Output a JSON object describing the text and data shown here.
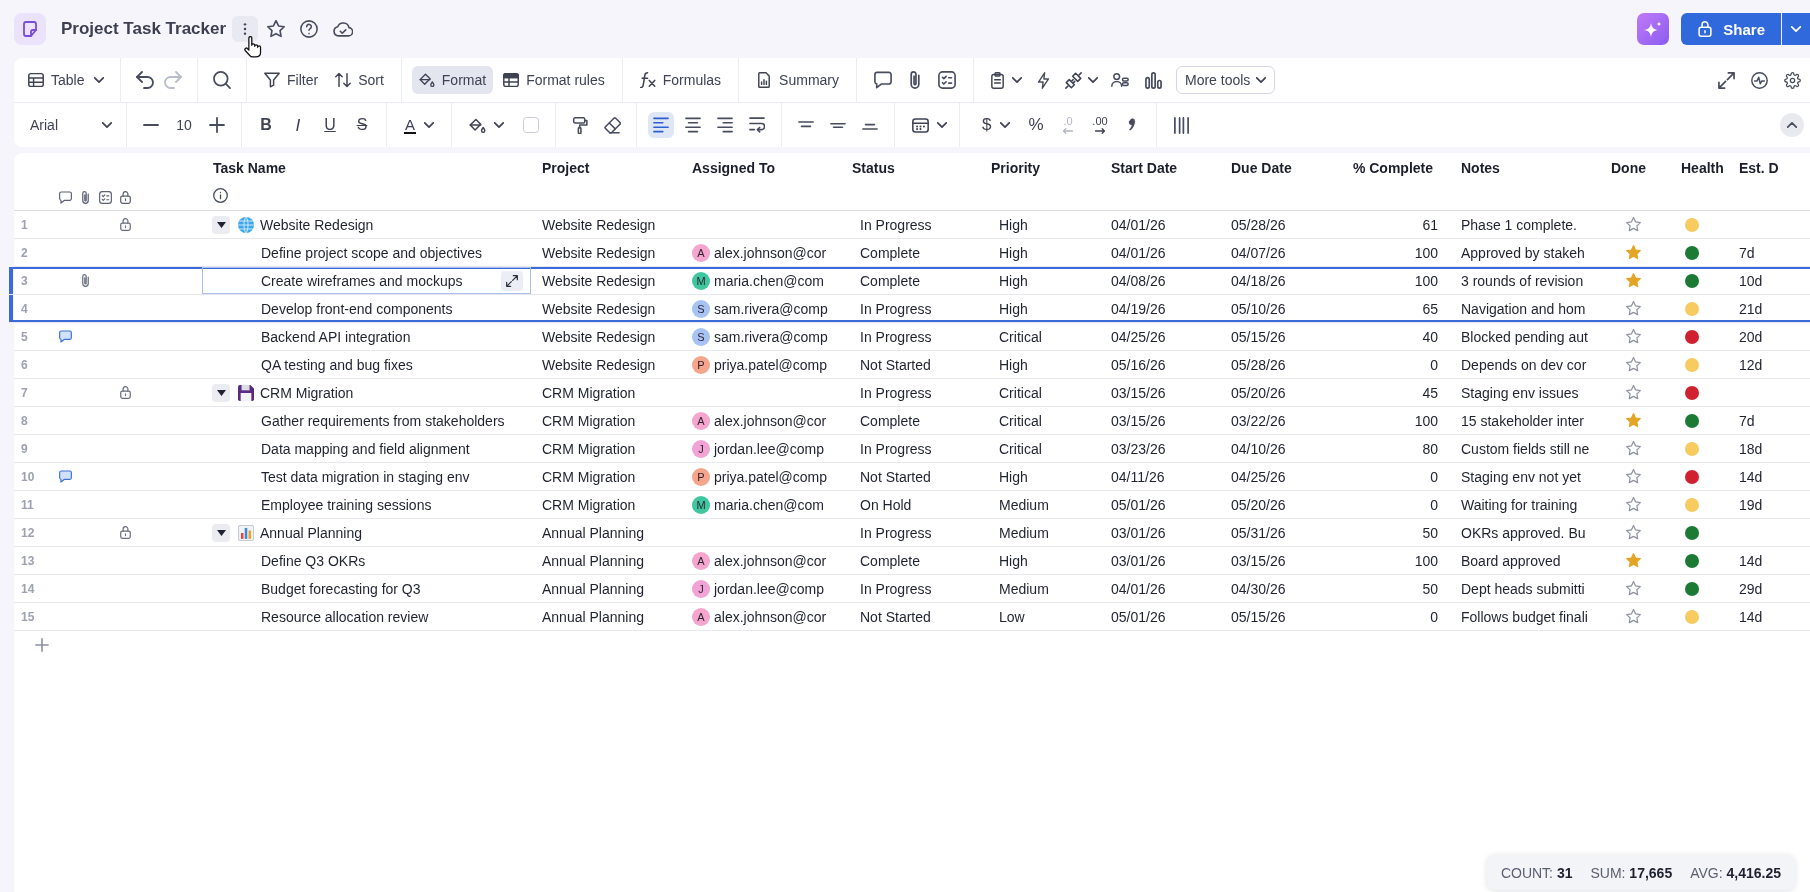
{
  "header": {
    "title": "Project Task Tracker",
    "share": "Share"
  },
  "toolbar": {
    "view": "Table",
    "history": [
      {
        "disabled": false
      },
      {
        "disabled": true
      }
    ],
    "tool_groups": [
      [
        {
          "label": "Filter",
          "selected": false
        },
        {
          "label": "Sort",
          "selected": false
        }
      ],
      [
        {
          "label": "Format",
          "selected": true
        },
        {
          "label": "Format rules",
          "selected": false
        }
      ],
      [
        {
          "label": "Formulas",
          "selected": false
        }
      ],
      [
        {
          "label": "Summary",
          "selected": false
        }
      ]
    ],
    "more_tools": "More tools"
  },
  "format_bar": {
    "font": "Arial",
    "size": "10",
    "text_styles": [
      "B",
      "I",
      "U",
      "S"
    ],
    "text_color": "A",
    "align": [
      {
        "selected": true
      },
      {
        "selected": false
      },
      {
        "selected": false
      },
      {
        "selected": false
      }
    ],
    "valign": [
      {
        "selected": false
      },
      {
        "selected": false
      },
      {
        "selected": false
      }
    ],
    "currency": "$",
    "percent": "%",
    "decimals": [
      {
        "label": ".0",
        "disabled": true
      },
      {
        "label": ".00",
        "disabled": false
      }
    ]
  },
  "table": {
    "columns": [
      "Task Name",
      "Project",
      "Assigned To",
      "Status",
      "Priority",
      "Start Date",
      "Due Date",
      "% Complete",
      "Notes",
      "Done",
      "Health",
      "Est. D"
    ],
    "rows": [
      {
        "num": "1",
        "task": "Website Redesign",
        "project": "Website Redesign",
        "status": "In Progress",
        "priority": "High",
        "start": "04/01/26",
        "due": "05/28/26",
        "percent": "61",
        "notes": "Phase 1 complete.",
        "done": false,
        "health": {
          "color": "#f7cb5f"
        },
        "comment": false,
        "attachment": false,
        "locked": true,
        "selected": false,
        "focused": false,
        "expanded": true,
        "children": [
          {
            "num": "2",
            "task": "Define project scope and objectives",
            "project": "Website Redesign",
            "assignee": {
              "initial": "A",
              "email": "alex.johnson@cor",
              "color": "#f4a6cf"
            },
            "status": "Complete",
            "priority": "High",
            "start": "04/01/26",
            "due": "04/07/26",
            "percent": "100",
            "notes": "Approved by stakeh",
            "done": true,
            "health": {
              "color": "#1c7a35"
            },
            "estimate": "7d",
            "comment": false,
            "attachment": false,
            "locked": false,
            "selected": false,
            "focused": false
          },
          {
            "num": "3",
            "task": "Create wireframes and mockups",
            "project": "Website Redesign",
            "assignee": {
              "initial": "M",
              "email": "maria.chen@com",
              "color": "#3fc7a0"
            },
            "status": "Complete",
            "priority": "High",
            "start": "04/08/26",
            "due": "04/18/26",
            "percent": "100",
            "notes": "3 rounds of revision",
            "done": true,
            "health": {
              "color": "#1c7a35"
            },
            "estimate": "10d",
            "comment": false,
            "attachment": true,
            "locked": false,
            "selected": true,
            "focused": true
          },
          {
            "num": "4",
            "task": "Develop front-end components",
            "project": "Website Redesign",
            "assignee": {
              "initial": "S",
              "email": "sam.rivera@comp",
              "color": "#a7c3f4"
            },
            "status": "In Progress",
            "priority": "High",
            "start": "04/19/26",
            "due": "05/10/26",
            "percent": "65",
            "notes": "Navigation and hom",
            "done": false,
            "health": {
              "color": "#f7cb5f"
            },
            "estimate": "21d",
            "comment": false,
            "attachment": false,
            "locked": false,
            "selected": true,
            "focused": false
          },
          {
            "num": "5",
            "task": "Backend API integration",
            "project": "Website Redesign",
            "assignee": {
              "initial": "S",
              "email": "sam.rivera@comp",
              "color": "#a7c3f4"
            },
            "status": "In Progress",
            "priority": "Critical",
            "start": "04/25/26",
            "due": "05/15/26",
            "percent": "40",
            "notes": "Blocked pending aut",
            "done": false,
            "health": {
              "color": "#d1202f"
            },
            "estimate": "20d",
            "comment": true,
            "attachment": false,
            "locked": false,
            "selected": false,
            "focused": false
          },
          {
            "num": "6",
            "task": "QA testing and bug fixes",
            "project": "Website Redesign",
            "assignee": {
              "initial": "P",
              "email": "priya.patel@comp",
              "color": "#f5a58b"
            },
            "status": "Not Started",
            "priority": "High",
            "start": "05/16/26",
            "due": "05/28/26",
            "percent": "0",
            "notes": "Depends on dev cor",
            "done": false,
            "health": {
              "color": "#f7cb5f"
            },
            "estimate": "12d",
            "comment": false,
            "attachment": false,
            "locked": false,
            "selected": false,
            "focused": false
          }
        ]
      },
      {
        "num": "7",
        "task": "CRM Migration",
        "project": "CRM Migration",
        "status": "In Progress",
        "priority": "Critical",
        "start": "03/15/26",
        "due": "05/20/26",
        "percent": "45",
        "notes": "Staging env issues",
        "done": false,
        "health": {
          "color": "#d1202f"
        },
        "comment": false,
        "attachment": false,
        "locked": true,
        "selected": false,
        "focused": false,
        "expanded": true,
        "children": [
          {
            "num": "8",
            "task": "Gather requirements from stakeholders",
            "project": "CRM Migration",
            "assignee": {
              "initial": "A",
              "email": "alex.johnson@cor",
              "color": "#f4a6cf"
            },
            "status": "Complete",
            "priority": "Critical",
            "start": "03/15/26",
            "due": "03/22/26",
            "percent": "100",
            "notes": "15 stakeholder inter",
            "done": true,
            "health": {
              "color": "#1c7a35"
            },
            "estimate": "7d",
            "comment": false,
            "attachment": false,
            "locked": false,
            "selected": false,
            "focused": false
          },
          {
            "num": "9",
            "task": "Data mapping and field alignment",
            "project": "CRM Migration",
            "assignee": {
              "initial": "J",
              "email": "jordan.lee@comp",
              "color": "#f1a3d6"
            },
            "status": "In Progress",
            "priority": "Critical",
            "start": "03/23/26",
            "due": "04/10/26",
            "percent": "80",
            "notes": "Custom fields still ne",
            "done": false,
            "health": {
              "color": "#f7cb5f"
            },
            "estimate": "18d",
            "comment": false,
            "attachment": false,
            "locked": false,
            "selected": false,
            "focused": false
          },
          {
            "num": "10",
            "task": "Test data migration in staging env",
            "project": "CRM Migration",
            "assignee": {
              "initial": "P",
              "email": "priya.patel@comp",
              "color": "#f5a58b"
            },
            "status": "Not Started",
            "priority": "High",
            "start": "04/11/26",
            "due": "04/25/26",
            "percent": "0",
            "notes": "Staging env not yet",
            "done": false,
            "health": {
              "color": "#d1202f"
            },
            "estimate": "14d",
            "comment": true,
            "attachment": false,
            "locked": false,
            "selected": false,
            "focused": false
          },
          {
            "num": "11",
            "task": "Employee training sessions",
            "project": "CRM Migration",
            "assignee": {
              "initial": "M",
              "email": "maria.chen@com",
              "color": "#3fc7a0"
            },
            "status": "On Hold",
            "priority": "Medium",
            "start": "05/01/26",
            "due": "05/20/26",
            "percent": "0",
            "notes": "Waiting for training",
            "done": false,
            "health": {
              "color": "#f7cb5f"
            },
            "estimate": "19d",
            "comment": false,
            "attachment": false,
            "locked": false,
            "selected": false,
            "focused": false
          }
        ]
      },
      {
        "num": "12",
        "task": "Annual Planning",
        "project": "Annual Planning",
        "status": "In Progress",
        "priority": "Medium",
        "start": "03/01/26",
        "due": "05/31/26",
        "percent": "50",
        "notes": "OKRs approved. Bu",
        "done": false,
        "health": {
          "color": "#1c7a35"
        },
        "comment": false,
        "attachment": false,
        "locked": true,
        "selected": false,
        "focused": false,
        "expanded": true,
        "children": [
          {
            "num": "13",
            "task": "Define Q3 OKRs",
            "project": "Annual Planning",
            "assignee": {
              "initial": "A",
              "email": "alex.johnson@cor",
              "color": "#f4a6cf"
            },
            "status": "Complete",
            "priority": "High",
            "start": "03/01/26",
            "due": "03/15/26",
            "percent": "100",
            "notes": "Board approved",
            "done": true,
            "health": {
              "color": "#1c7a35"
            },
            "estimate": "14d",
            "comment": false,
            "attachment": false,
            "locked": false,
            "selected": false,
            "focused": false
          },
          {
            "num": "14",
            "task": "Budget forecasting for Q3",
            "project": "Annual Planning",
            "assignee": {
              "initial": "J",
              "email": "jordan.lee@comp",
              "color": "#f1a3d6"
            },
            "status": "In Progress",
            "priority": "Medium",
            "start": "04/01/26",
            "due": "04/30/26",
            "percent": "50",
            "notes": "Dept heads submitti",
            "done": false,
            "health": {
              "color": "#1c7a35"
            },
            "estimate": "29d",
            "comment": false,
            "attachment": false,
            "locked": false,
            "selected": false,
            "focused": false
          },
          {
            "num": "15",
            "task": "Resource allocation review",
            "project": "Annual Planning",
            "assignee": {
              "initial": "A",
              "email": "alex.johnson@cor",
              "color": "#f4a6cf"
            },
            "status": "Not Started",
            "priority": "Low",
            "start": "05/01/26",
            "due": "05/15/26",
            "percent": "0",
            "notes": "Follows budget finali",
            "done": false,
            "health": {
              "color": "#f7cb5f"
            },
            "estimate": "14d",
            "comment": false,
            "attachment": false,
            "locked": false,
            "selected": false,
            "focused": false
          }
        ]
      }
    ]
  },
  "status_bar": [
    "COUNT: **31**",
    "SUM: **17,665**",
    "AVG: **4,416.25**"
  ]
}
